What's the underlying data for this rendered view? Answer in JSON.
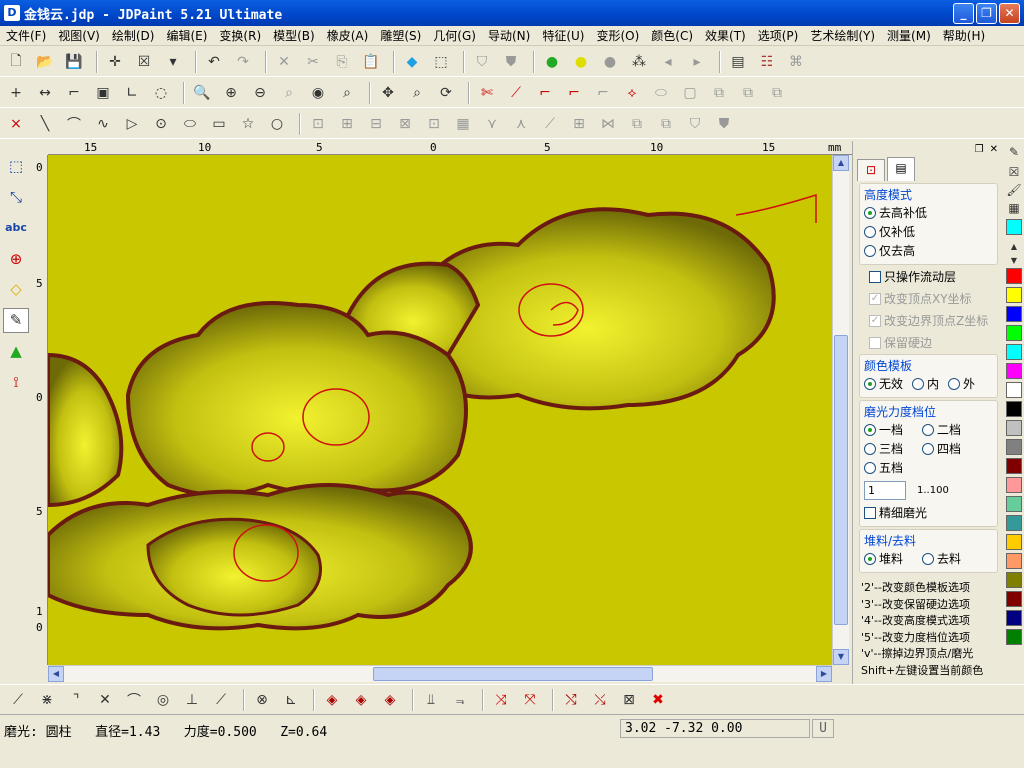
{
  "window": {
    "title": "金钱云.jdp - JDPaint 5.21 Ultimate",
    "app_icon": "JDPaint-icon"
  },
  "menu": [
    "文件(F)",
    "视图(V)",
    "绘制(D)",
    "编辑(E)",
    "变换(R)",
    "模型(B)",
    "橡皮(A)",
    "雕塑(S)",
    "几何(G)",
    "导动(N)",
    "特征(U)",
    "变形(O)",
    "颜色(C)",
    "效果(T)",
    "选项(P)",
    "艺术绘制(Y)",
    "测量(M)",
    "帮助(H)"
  ],
  "ruler": {
    "unit": "mm",
    "h_ticks": [
      "15",
      "10",
      "5",
      "0",
      "5",
      "10",
      "15"
    ],
    "v_ticks": [
      "0",
      "5",
      "0",
      "5",
      "1",
      "0"
    ]
  },
  "panel": {
    "height_mode": {
      "label": "高度模式",
      "options": [
        "去高补低",
        "仅补低",
        "仅去高"
      ],
      "selected": 0
    },
    "flow_layer_only": "只操作流动层",
    "change_vertex_xy": "改变顶点XY坐标",
    "change_border_z": "改变边界顶点Z坐标",
    "keep_hard_edge": "保留硬边",
    "color_template": {
      "label": "颜色模板",
      "options": [
        "无效",
        "内",
        "外"
      ],
      "selected": 0
    },
    "polish_level": {
      "label": "磨光力度档位",
      "options": [
        "一档",
        "二档",
        "三档",
        "四档",
        "五档"
      ],
      "selected": 0,
      "value": "1",
      "range": "1..100",
      "fine": "精细磨光"
    },
    "material": {
      "label": "堆料/去料",
      "options": [
        "堆料",
        "去料"
      ],
      "selected": 0
    },
    "tips": [
      "'2'--改变颜色模板选项",
      "'3'--改变保留硬边选项",
      "'4'--改变高度模式选项",
      "'5'--改变力度档位选项",
      "'v'--擦掉边界顶点/磨光",
      "Shift+左键设置当前颜色"
    ]
  },
  "palette": [
    "#ff0000",
    "#ffff00",
    "#0000ff",
    "#00ff00",
    "#00ffff",
    "#ff00ff",
    "#ffffff",
    "#000000",
    "#c0c0c0",
    "#808080",
    "#800000",
    "#ff9999",
    "#66cc99",
    "#339999",
    "#ffcc00",
    "#ff9966",
    "#808000",
    "#800000",
    "#000080",
    "#008000"
  ],
  "status": {
    "mode": "磨光: 圆柱",
    "diameter": "直径=1.43",
    "force": "力度=0.500",
    "z": "Z=0.64",
    "coords": "3.02  -7.32  0.00",
    "unit_box": "U"
  }
}
